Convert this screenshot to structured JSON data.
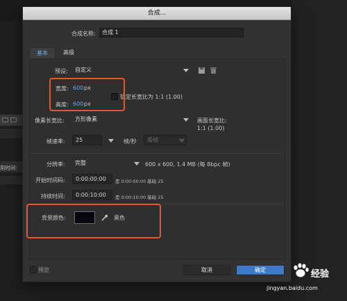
{
  "dialog": {
    "title": "合成..."
  },
  "background": {
    "time_label": "用时间:"
  },
  "comp_name": {
    "label": "合成名称:",
    "value": "合成 1"
  },
  "tabs": [
    {
      "label": "基本",
      "active": true
    },
    {
      "label": "高级",
      "active": false
    }
  ],
  "preset": {
    "label": "预设:",
    "value": "自定义"
  },
  "width": {
    "label": "宽度:",
    "value": "600",
    "unit": "px"
  },
  "height": {
    "label": "高度:",
    "value": "600",
    "unit": "px"
  },
  "lock_aspect": {
    "label": "锁定长宽比为 1:1 (1.00)",
    "checked": false
  },
  "pixel_aspect": {
    "label": "像素长宽比:",
    "value": "方形像素",
    "frame_aspect_label": "画面长宽比:",
    "frame_aspect_value": "1:1 (1.00)"
  },
  "frame_rate": {
    "label": "帧速率:",
    "value": "25",
    "unit": "帧/秒",
    "drop_frame": "丢帧"
  },
  "resolution": {
    "label": "分辨率:",
    "value": "完整",
    "info": "600 x 600, 1.4 MB (每 8bpc 帧)"
  },
  "start_timecode": {
    "label": "开始时间码:",
    "value": "0:00:00:00",
    "info": "是 0:00:00:00  基础 25"
  },
  "duration": {
    "label": "持续时间:",
    "value": "0:00:10:00",
    "info": "是 0:00:10:00  基础 25"
  },
  "background_color": {
    "label": "背景颜色:",
    "name": "黑色",
    "color": "#07080f"
  },
  "preview": {
    "label": "预览",
    "checked": false
  },
  "buttons": {
    "cancel": "取消",
    "ok": "确定"
  },
  "watermark": {
    "text": "经验",
    "url": "jingyan.baidu.com"
  },
  "colors": {
    "accent_blue": "#6aa9ec",
    "highlight_orange": "#e8562b",
    "ok_button": "#3d7ac8"
  }
}
